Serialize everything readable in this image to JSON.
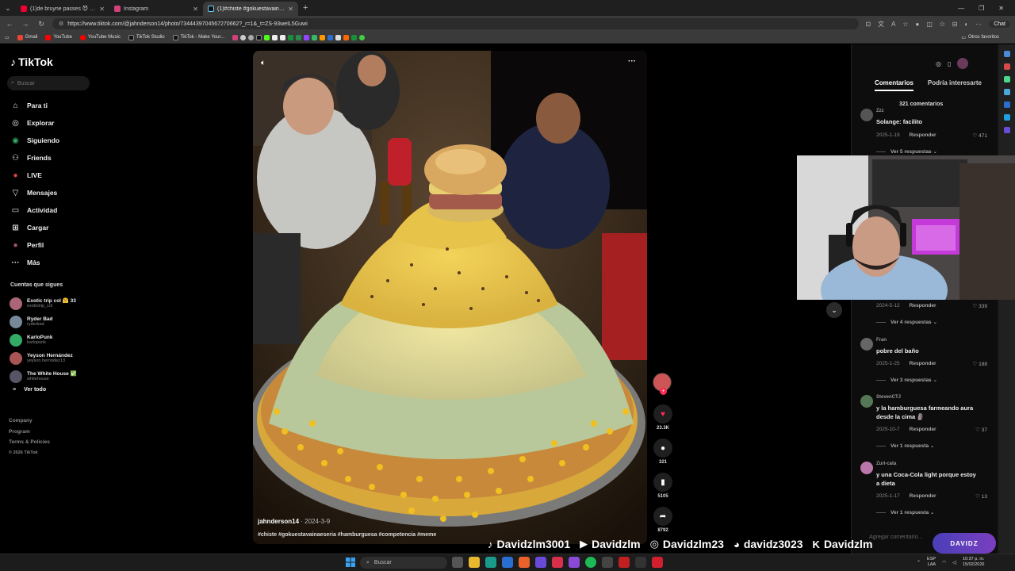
{
  "browser": {
    "tabs": [
      {
        "label": "(1)de bruyne passes 😈 #foryo",
        "color": "#e03"
      },
      {
        "label": "Instagram",
        "color": "#d2417a"
      },
      {
        "label": "(1)#chiste #gokuestavainaeseria",
        "color": "#111"
      }
    ],
    "url": "https://www.tiktok.com/@jahnderson14/photo/7344439704567270662?_r=1&_t=ZS-93weIL5Guwi",
    "chat_label": "Chat",
    "bookmarks": [
      {
        "label": "Gmail",
        "color": "#ea4335"
      },
      {
        "label": "YouTube",
        "color": "#ff0000"
      },
      {
        "label": "YouTube Music",
        "color": "#ff0000"
      },
      {
        "label": "TikTok Studio",
        "color": "#111"
      },
      {
        "label": "TikTok - Make Your...",
        "color": "#111"
      }
    ],
    "other_bookmarks": "Otros favoritos"
  },
  "sidebar": {
    "logo": "TikTok",
    "search_placeholder": "Buscar",
    "nav": [
      {
        "label": "Para ti",
        "icon": "⌂"
      },
      {
        "label": "Explorar",
        "icon": "◎"
      },
      {
        "label": "Siguiendo",
        "icon": "◉"
      },
      {
        "label": "Friends",
        "icon": "⚇"
      },
      {
        "label": "LIVE",
        "icon": "●"
      },
      {
        "label": "Mensajes",
        "icon": "▽"
      },
      {
        "label": "Actividad",
        "icon": "▭"
      },
      {
        "label": "Cargar",
        "icon": "⊞"
      },
      {
        "label": "Perfil",
        "icon": "●"
      },
      {
        "label": "Más",
        "icon": "···"
      }
    ],
    "following_title": "Cuentas que sigues",
    "following": [
      {
        "name": "Exotic trip col 🤗 33",
        "handle": "exotictrip_col",
        "color": "#a67"
      },
      {
        "name": "Ryder Bad",
        "handle": "ryderbad",
        "color": "#789"
      },
      {
        "name": "KarloPunk",
        "handle": "karlopunk",
        "color": "#3a6"
      },
      {
        "name": "Yeyson Hernández",
        "handle": "yeyson.hernndez13",
        "color": "#a55"
      },
      {
        "name": "The White House ✅",
        "handle": "whitehouse",
        "color": "#556"
      }
    ],
    "see_all": "Ver todo",
    "footer": [
      "Company",
      "Program",
      "Terms & Policies"
    ],
    "copyright": "© 2026 TikTok"
  },
  "video": {
    "author": "jahnderson14",
    "date": "2024-3-9",
    "hashtags": "#chiste #gokuestavainaeseria #hamburguesa #competencia #meme"
  },
  "actions": {
    "likes": "23.3K",
    "comments": "321",
    "saves": "5105",
    "shares": "8792"
  },
  "comments_panel": {
    "tabs": [
      "Comentarios",
      "Podría interesarte"
    ],
    "count": "321 comentarios",
    "reply_label": "Responder",
    "add_placeholder": "Agregar comentario...",
    "items": [
      {
        "user": "Zzz",
        "text": "Solange: facilito",
        "date": "2025-1-19",
        "likes": "471",
        "more": "Ver 5 respuestas",
        "color": "#555"
      },
      {
        "user": "",
        "text": "",
        "date": "2024-5-12",
        "likes": "339",
        "more": "Ver 4 respuestas",
        "color": "#555"
      },
      {
        "user": "Fran",
        "text": "pobre del baño",
        "date": "2025-1-25",
        "likes": "188",
        "more": "Ver 3 respuestas",
        "color": "#666"
      },
      {
        "user": "StevenCTJ",
        "text": "y la hamburguesa farmeando aura desde la cima 🗿",
        "date": "2025-10-7",
        "likes": "37",
        "more": "Ver 1 respuesta",
        "color": "#575"
      },
      {
        "user": "Zuri-cata",
        "text": "y una Coca-Cola light porque estoy a dieta",
        "date": "2025-1-17",
        "likes": "13",
        "more": "Ver 1 respuesta",
        "color": "#b7a"
      }
    ]
  },
  "stream_overlay": {
    "socials": [
      {
        "icon": "♪",
        "label": "Davidzlm3001"
      },
      {
        "icon": "▶",
        "label": "Davidzlm"
      },
      {
        "icon": "◎",
        "label": "Davidzlm23"
      },
      {
        "icon": "◕",
        "label": "davidz3023"
      },
      {
        "icon": "K",
        "label": "Davidzlm"
      }
    ],
    "brand": "DAVIDZ"
  },
  "taskbar": {
    "search_placeholder": "Buscar",
    "lang": "ESP",
    "lang2": "LAA",
    "time": "10:37 p. m.",
    "date": "15/02/2026"
  }
}
